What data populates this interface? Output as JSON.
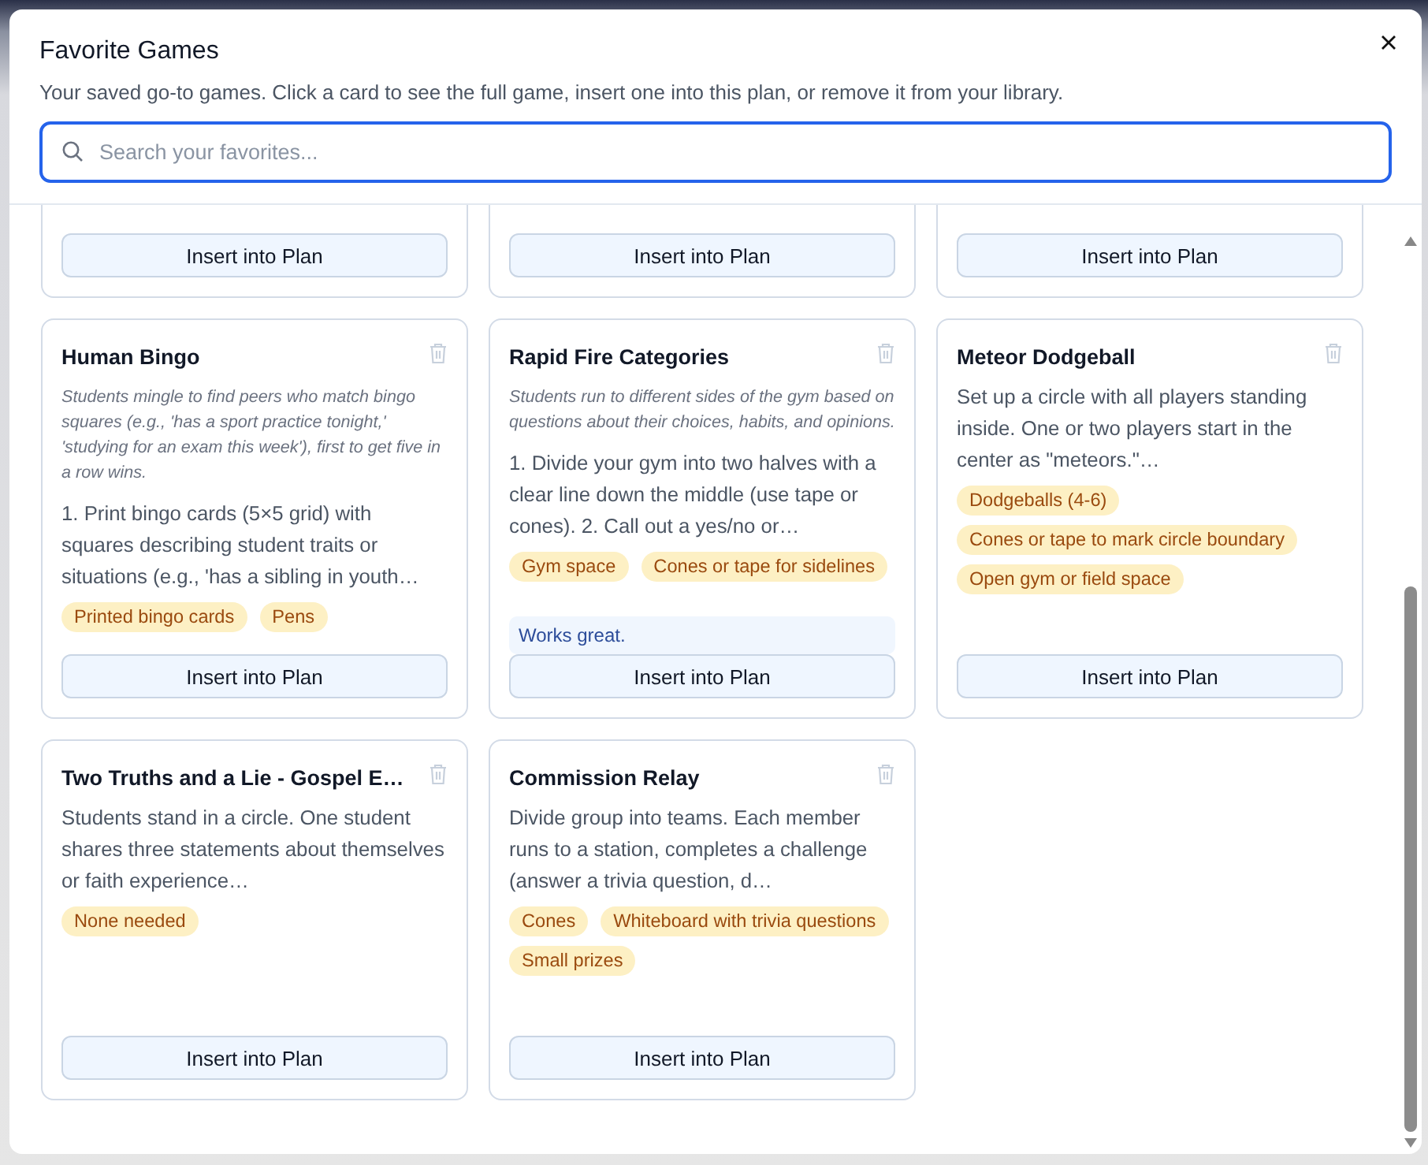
{
  "dialog": {
    "title": "Favorite Games",
    "subtitle": "Your saved go-to games. Click a card to see the full game, insert one into this plan, or remove it from your library.",
    "search": {
      "placeholder": "Search your favorites..."
    }
  },
  "partial_cards": [
    {
      "button": "Insert into Plan"
    },
    {
      "button": "Insert into Plan"
    },
    {
      "button": "Insert into Plan"
    }
  ],
  "cards": [
    {
      "title": "Human Bingo",
      "summary": "Students mingle to find peers who match bingo squares (e.g., 'has a sport practice tonight,' 'studying for an exam this week'), first to get five in a row wins.",
      "description": "1. Print bingo cards (5×5 grid) with squares describing student traits or situations (e.g., 'has a sibling in youth…",
      "tags": [
        "Printed bingo cards",
        "Pens"
      ],
      "button": "Insert into Plan"
    },
    {
      "title": "Rapid Fire Categories",
      "summary": "Students run to different sides of the gym based on questions about their choices, habits, and opinions.",
      "description": "1. Divide your gym into two halves with a clear line down the middle (use tape or cones). 2. Call out a yes/no or…",
      "tags": [
        "Gym space",
        "Cones or tape for sidelines"
      ],
      "note": "Works great.",
      "button": "Insert into Plan"
    },
    {
      "title": "Meteor Dodgeball",
      "description": "Set up a circle with all players standing inside. One or two players start in the center as \"meteors.\"…",
      "tags": [
        "Dodgeballs (4-6)",
        "Cones or tape to mark circle boundary",
        "Open gym or field space"
      ],
      "button": "Insert into Plan"
    },
    {
      "title": "Two Truths and a Lie - Gospel E…",
      "description": "Students stand in a circle. One student shares three statements about themselves or faith experience…",
      "tags": [
        "None needed"
      ],
      "button": "Insert into Plan"
    },
    {
      "title": "Commission Relay",
      "description": "Divide group into teams. Each member runs to a station, completes a challenge (answer a trivia question, d…",
      "tags": [
        "Cones",
        "Whiteboard with trivia questions",
        "Small prizes"
      ],
      "button": "Insert into Plan"
    }
  ]
}
